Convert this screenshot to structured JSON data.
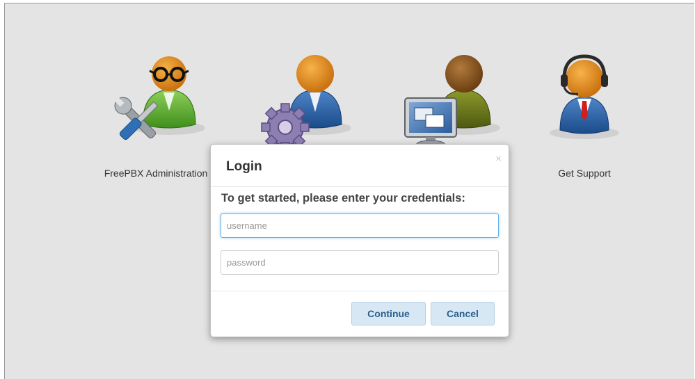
{
  "tiles": [
    {
      "label": "FreePBX Administration",
      "icon": "admin-tools-icon"
    },
    {
      "label": "",
      "icon": "user-settings-icon"
    },
    {
      "label": "",
      "icon": "user-panel-icon"
    },
    {
      "label": "Get Support",
      "icon": "support-headset-icon"
    }
  ],
  "dialog": {
    "title": "Login",
    "close_label": "×",
    "prompt": "To get started, please enter your credentials:",
    "username": {
      "value": "",
      "placeholder": "username"
    },
    "password": {
      "value": "",
      "placeholder": "password"
    },
    "continue_label": "Continue",
    "cancel_label": "Cancel"
  },
  "colors": {
    "background": "#e4e4e4",
    "button_bg": "#d7e8f4",
    "button_text": "#2b5f8f",
    "focus_border": "#66afe9"
  }
}
